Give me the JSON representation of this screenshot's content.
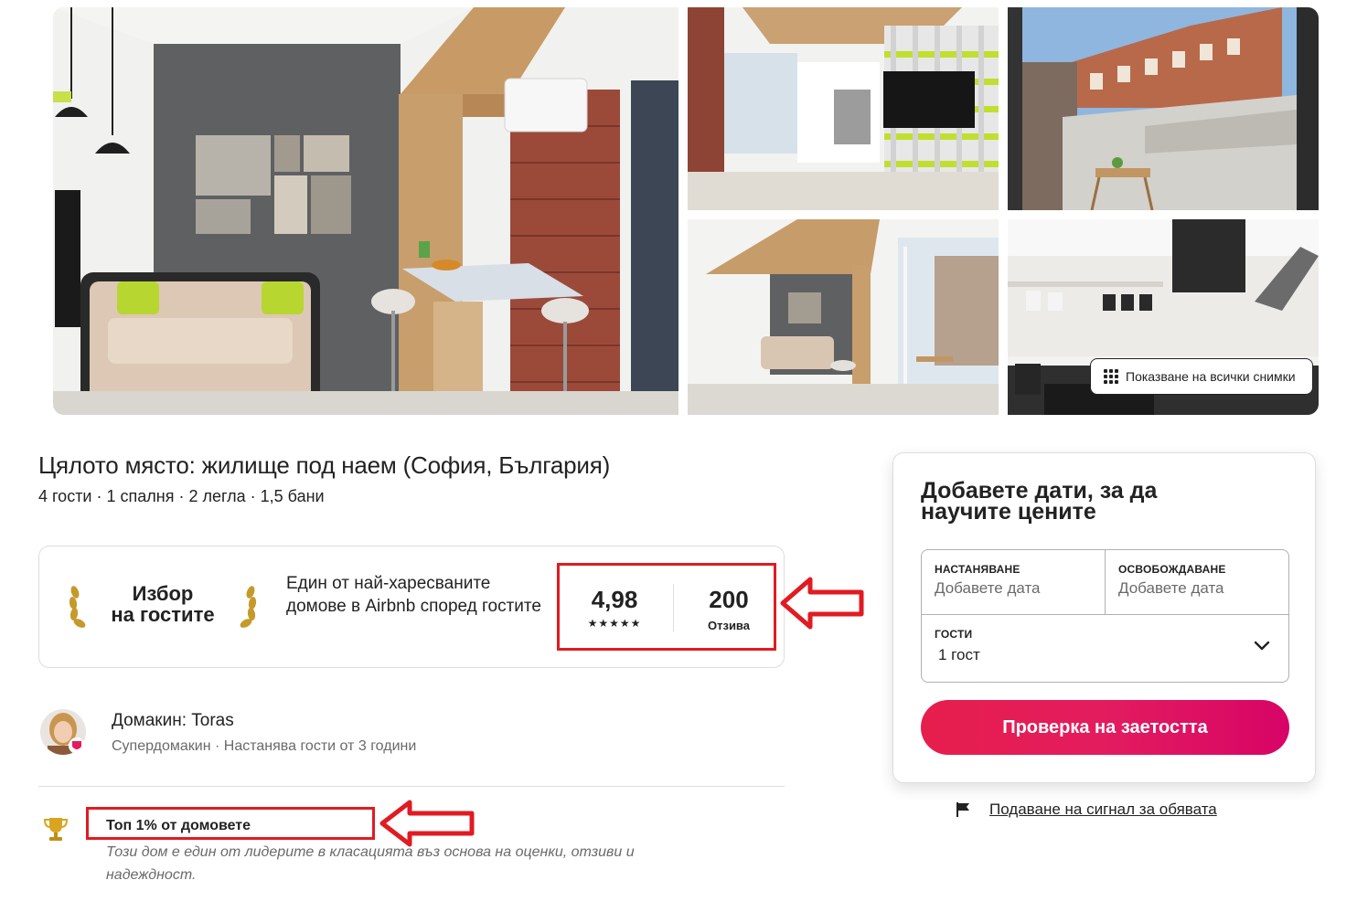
{
  "gallery": {
    "show_all_label": "Показване на всички снимки"
  },
  "listing": {
    "title": "Цялото място: жилище под наем (София, България)",
    "subtitle": "4 гости · 1 спалня · 2 легла · 1,5 бани"
  },
  "guest_favorite": {
    "badge_line1": "Избор",
    "badge_line2": "на гостите",
    "description": "Един от най-харесваните домове в Airbnb според гостите",
    "rating": "4,98",
    "stars": "★★★★★",
    "reviews_count": "200",
    "reviews_label": "Отзива"
  },
  "host": {
    "name": "Домакин: Toras",
    "meta": "Супердомакин · Настанява гости от 3 години"
  },
  "highlight": {
    "title": "Топ 1% от домовете",
    "description": "Този дом е един от лидерите в класацията въз основа на оценки, отзиви и надеждност."
  },
  "booking": {
    "title": "Добавете дати, за да научите цените",
    "checkin_label": "НАСТАНЯВАНЕ",
    "checkin_value": "Добавете дата",
    "checkout_label": "ОСВОБОЖДАВАНЕ",
    "checkout_value": "Добавете дата",
    "guests_label": "ГОСТИ",
    "guests_value": "1 гост",
    "button_label": "Проверка на заетостта"
  },
  "report": {
    "label": "Подаване на сигнал за обявата"
  },
  "colors": {
    "accent": "#e31c5f",
    "annotation_red": "#e01b22",
    "text": "#222222",
    "muted": "#6a6a6a"
  }
}
